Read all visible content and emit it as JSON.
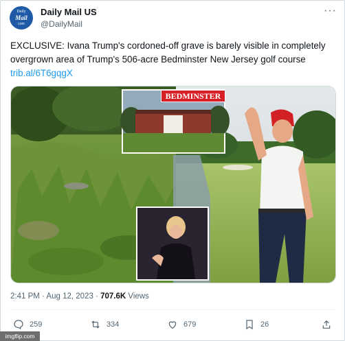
{
  "post": {
    "account_name": "Daily Mail US",
    "account_handle": "@DailyMail",
    "avatar_text": [
      "Daily",
      "Mail",
      "com"
    ],
    "more_label": "···",
    "text": "EXCLUSIVE: Ivana Trump's cordoned-off grave is barely visible in completely overgrown area of Trump's 506-acre Bedminster New Jersey golf course ",
    "link": "trib.al/6T6gqgX",
    "media": {
      "bedminster_label": "BEDMINSTER"
    },
    "timestamp": "2:41 PM · Aug 12, 2023 · ",
    "views_count": "707.6K",
    "views_label": " Views"
  },
  "actions": {
    "replies": "259",
    "reposts": "334",
    "likes": "679",
    "bookmarks": "26"
  },
  "colors": {
    "link": "#1d9bf0",
    "secondary_text": "#536471",
    "border": "#cfd9de"
  },
  "watermark": "imgflip.com"
}
